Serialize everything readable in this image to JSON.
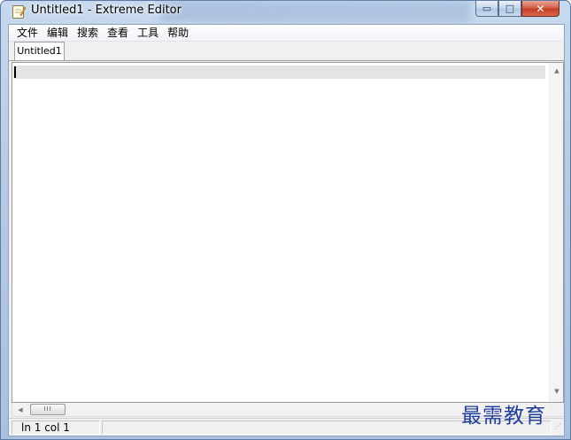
{
  "window": {
    "title": "Untitled1 - Extreme Editor",
    "caption_buttons": {
      "minimize": "▭",
      "maximize": "□",
      "close": "✕"
    }
  },
  "menubar": {
    "items": [
      "文件",
      "编辑",
      "搜索",
      "查看",
      "工具",
      "帮助"
    ]
  },
  "tabs": [
    {
      "label": "Untitled1",
      "active": true
    }
  ],
  "editor": {
    "content": ""
  },
  "scrollbars": {
    "vertical": {
      "up": "▲",
      "down": "▼"
    },
    "horizontal": {
      "left": "◀",
      "thumb_grip": "III"
    }
  },
  "statusbar": {
    "position": "ln 1 col 1",
    "grip": "⋰"
  },
  "watermark": {
    "text": "最需教育"
  },
  "colors": {
    "close_button": "#c3391f",
    "current_line": "#e4e4e4",
    "watermark": "#1f3e9c"
  }
}
